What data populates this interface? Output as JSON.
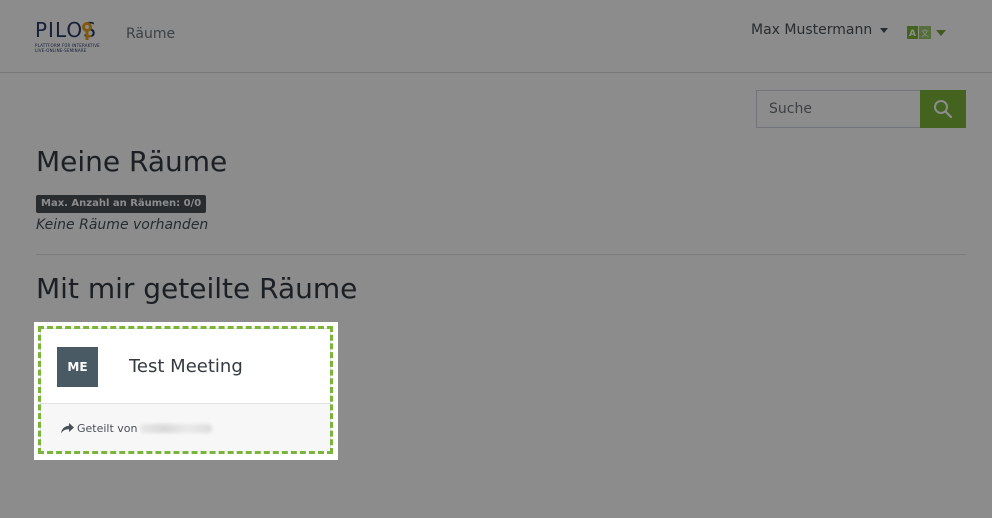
{
  "brand": {
    "logo_text": "PILOS",
    "logo_tagline": "PLATTFORM FÜR INTERAKTIVE\nLIVE-ONLINE-SEMINARE"
  },
  "nav": {
    "rooms_link": "Räume",
    "user_name": "Max Mustermann",
    "language_icon": "translate-icon"
  },
  "search": {
    "placeholder": "Suche",
    "button_icon": "search-icon"
  },
  "my_rooms": {
    "title": "Meine Räume",
    "limit_badge": "Max. Anzahl an Räumen: 0/0",
    "empty_text": "Keine Räume vorhanden"
  },
  "shared_rooms": {
    "title": "Mit mir geteilte Räume",
    "cards": [
      {
        "avatar_text": "ME",
        "name": "Test Meeting",
        "shared_by_label": "Geteilt von"
      }
    ]
  },
  "colors": {
    "accent": "#7ab53a",
    "brand_navy": "#2b3a67",
    "avatar_bg": "#495a64",
    "overlay": "rgba(0,0,0,0.45)"
  }
}
